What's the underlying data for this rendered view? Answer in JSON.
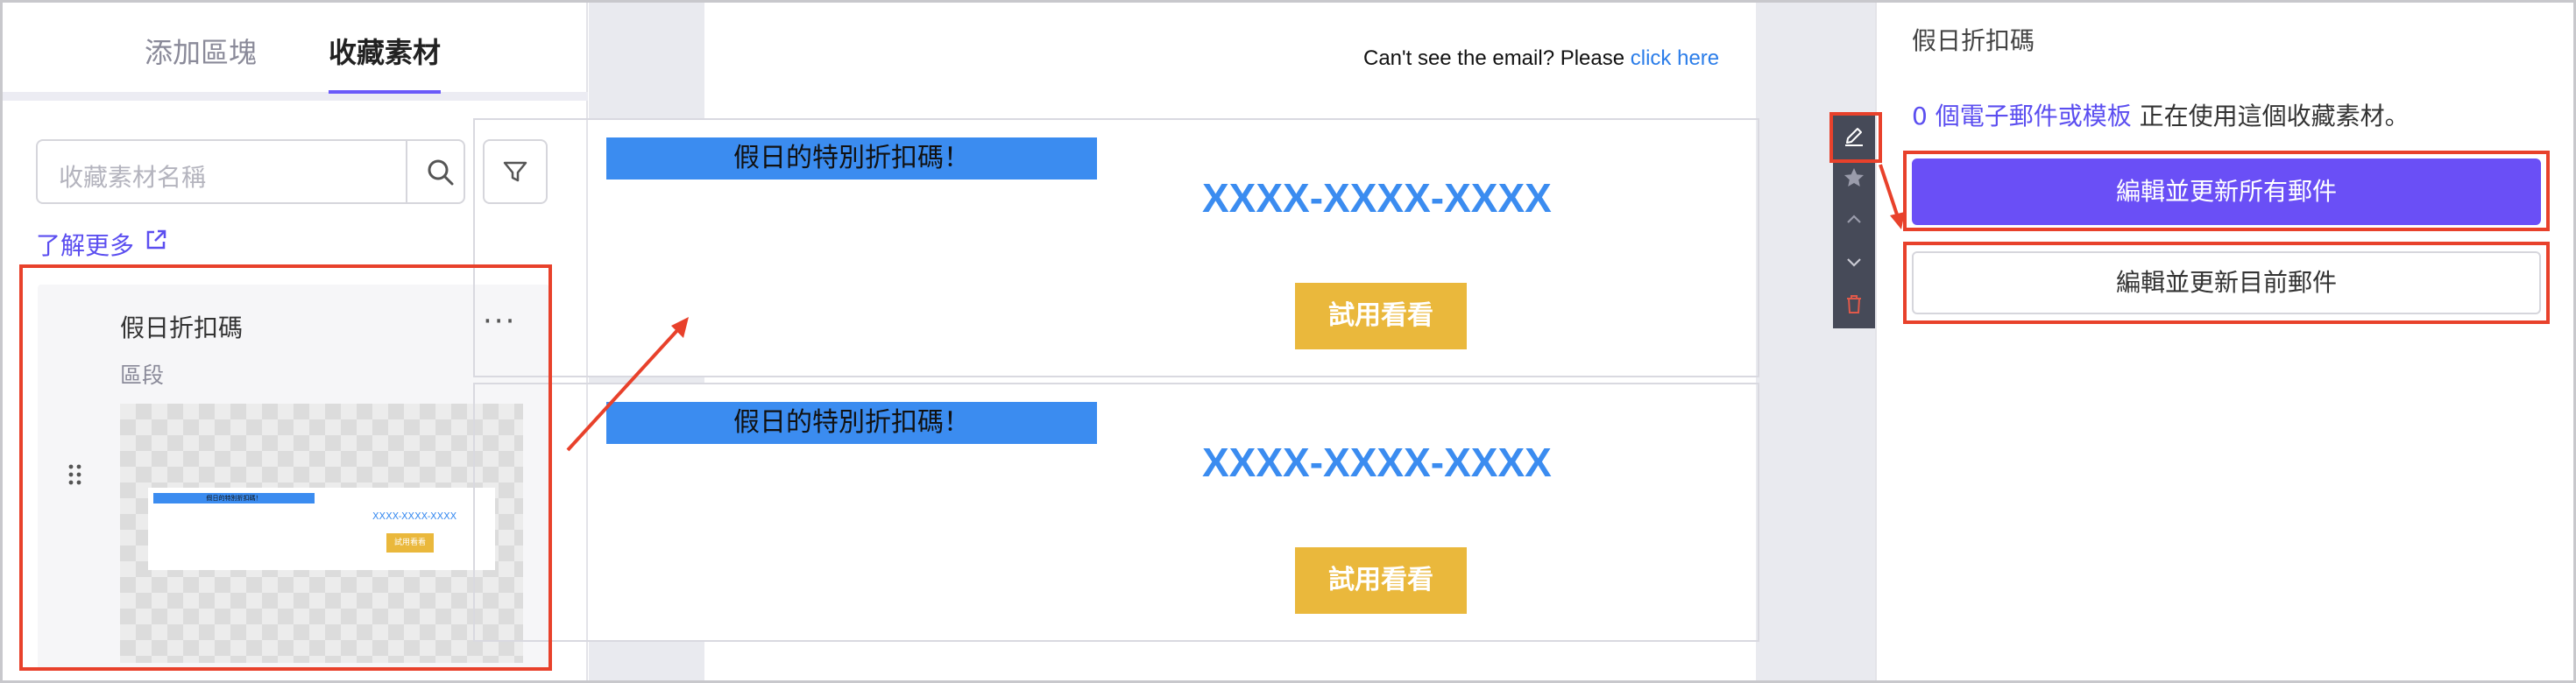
{
  "left_panel": {
    "tabs": [
      {
        "label": "添加區塊",
        "active": false
      },
      {
        "label": "收藏素材",
        "active": true
      }
    ],
    "search": {
      "placeholder": "收藏素材名稱"
    },
    "learn_more": "了解更多",
    "card": {
      "title": "假日折扣碼",
      "more": "···",
      "subtitle": "區段",
      "thumbnail": {
        "banner": "假日的特別折扣碼！",
        "code": "XXXX-XXXX-XXXX",
        "button": "試用看看"
      }
    }
  },
  "canvas": {
    "header_text": "Can't see the email? Please",
    "header_link": "click here",
    "sections": [
      {
        "banner": "假日的特別折扣碼！",
        "code": "XXXX-XXXX-XXXX",
        "button": "試用看看"
      },
      {
        "banner": "假日的特別折扣碼！",
        "code": "XXXX-XXXX-XXXX",
        "button": "試用看看"
      }
    ],
    "toolbar": [
      "pencil-icon",
      "star-icon",
      "chevron-up-icon",
      "chevron-down-icon",
      "trash-icon"
    ]
  },
  "right_panel": {
    "title": "假日折扣碼",
    "usage_link": "0 個電子郵件或模板",
    "usage_text": " 正在使用這個收藏素材。",
    "primary_button": "編輯並更新所有郵件",
    "secondary_button": "編輯並更新目前郵件"
  },
  "colors": {
    "accent": "#6a4ff6",
    "banner_blue": "#3b8cf0",
    "button_yellow": "#eab83c",
    "annotation_red": "#e8412b"
  }
}
